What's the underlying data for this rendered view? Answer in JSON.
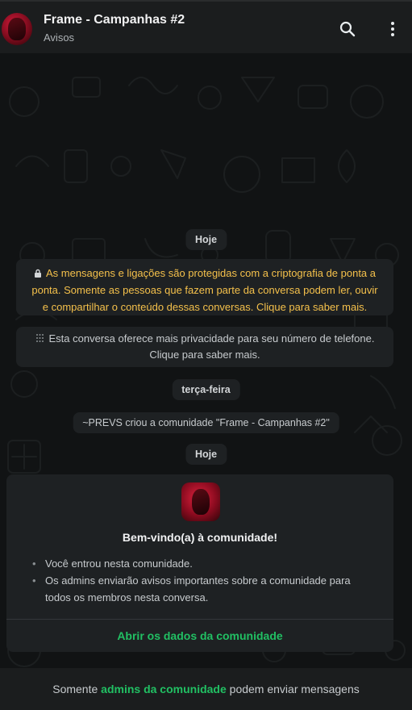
{
  "header": {
    "title": "Frame - Campanhas #2",
    "subtitle": "Avisos",
    "search_icon": "search-icon",
    "menu_icon": "more-vertical-icon"
  },
  "chat": {
    "date_today_1": "Hoje",
    "encryption_notice": "As mensagens e ligações são protegidas com a criptografia de ponta a ponta. Somente as pessoas que fazem parte da conversa podem ler, ouvir e compartilhar o conteúdo dessas conversas. Clique para saber mais.",
    "privacy_notice": "Esta conversa oferece mais privacidade para seu número de telefone. Clique para saber mais.",
    "date_tuesday": "terça-feira",
    "created_notice": "~PREVS criou a comunidade \"Frame - Campanhas #2\"",
    "date_today_2": "Hoje"
  },
  "welcome_card": {
    "title": "Bem-vindo(a) à comunidade!",
    "bullets": [
      "Você entrou nesta comunidade.",
      "Os admins enviarão avisos importantes sobre a comunidade para todos os membros nesta conversa."
    ],
    "link": "Abrir os dados da comunidade"
  },
  "footer": {
    "prefix": "Somente",
    "highlight": "admins da comunidade",
    "suffix": "podem enviar mensagens"
  },
  "colors": {
    "accent_green": "#21c063",
    "warning_yellow": "#f4c04b",
    "header_bg": "#1b1d1e",
    "bubble_bg": "#1e2123"
  }
}
